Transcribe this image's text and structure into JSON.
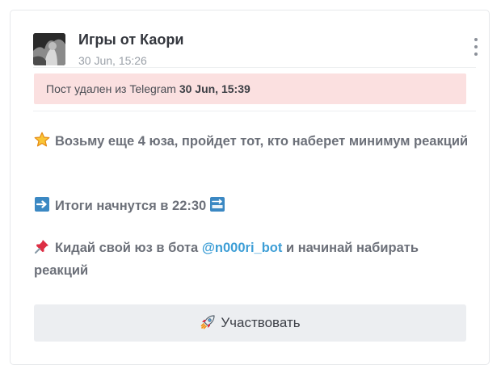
{
  "post": {
    "channel_name": "Игры от Каори",
    "date": "30 Jun, 15:26",
    "avatar_icon": "avatar-photo",
    "menu_icon": "more-vertical-icon"
  },
  "banner": {
    "text": "Пост удален из Telegram",
    "date": "30 Jun, 15:39",
    "background": "#fbe0e0"
  },
  "message": {
    "line1_icon": "star-icon",
    "line1_text": "Возьму еще 4 юза, пройдет тот, кто наберет минимум реакций",
    "line2_icon": "right-arrow-icon",
    "line2_text": "Итоги начнутся в 22:30",
    "line2_icon_after": "soon-arrow-icon",
    "line3_icon": "pushpin-icon",
    "line3_text_before": "Кидай свой юз в бота",
    "line3_link": "@n000ri_bot",
    "line3_text_after": "и начинай набирать реакций",
    "link_color": "#3d9ed6"
  },
  "actions": {
    "participate_label": "Участвовать",
    "participate_icon": "rocket-icon"
  }
}
